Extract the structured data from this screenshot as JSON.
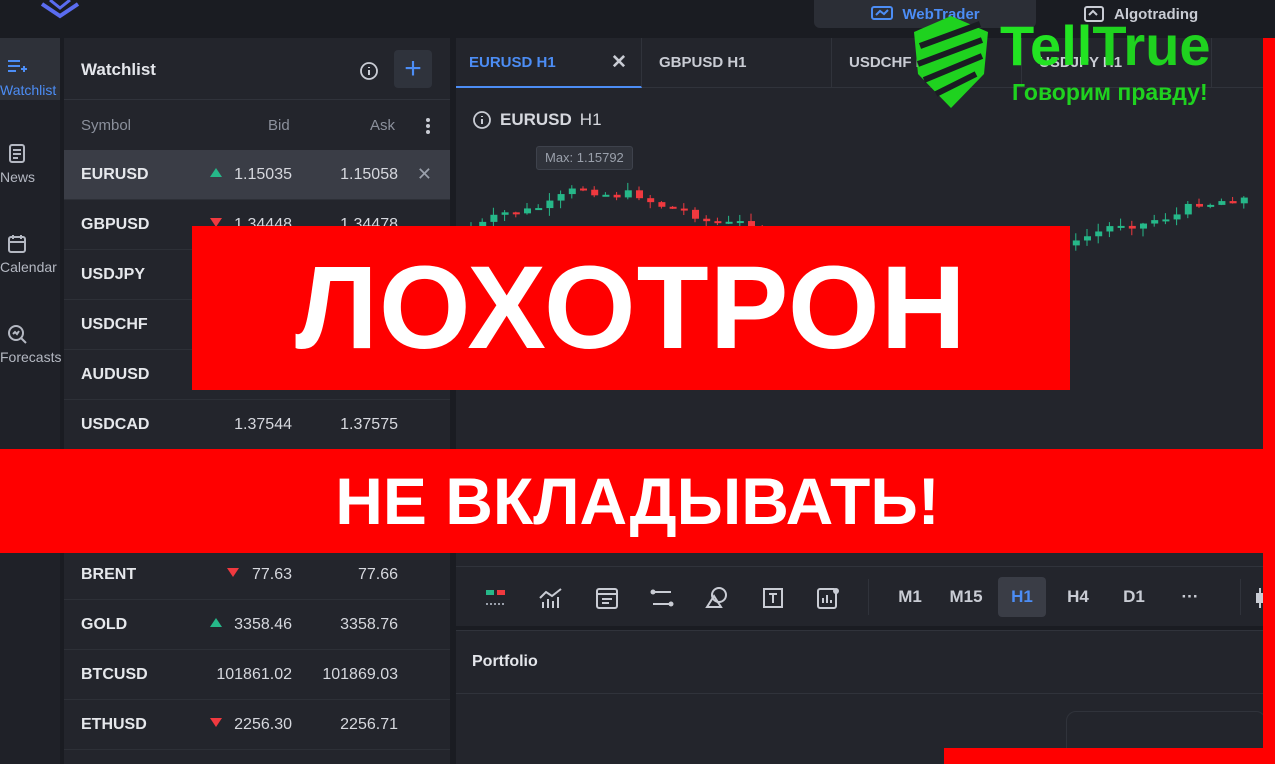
{
  "topbar": {
    "webtrader_label": "WebTrader",
    "algotrading_label": "Algotrading"
  },
  "nav": {
    "items": [
      {
        "label": "Watchlist",
        "icon": "watchlist-icon"
      },
      {
        "label": "News",
        "icon": "news-icon"
      },
      {
        "label": "Calendar",
        "icon": "calendar-icon"
      },
      {
        "label": "Forecasts",
        "icon": "forecasts-icon"
      }
    ]
  },
  "watchlist": {
    "title": "Watchlist",
    "columns": {
      "symbol": "Symbol",
      "bid": "Bid",
      "ask": "Ask"
    },
    "rows": [
      {
        "symbol": "EURUSD",
        "bid": "1.15035",
        "ask": "1.15058",
        "dir": "up",
        "selected": true
      },
      {
        "symbol": "GBPUSD",
        "bid": "1.34448",
        "ask": "1.34478",
        "dir": "down"
      },
      {
        "symbol": "USDJPY",
        "bid": "",
        "ask": "",
        "dir": ""
      },
      {
        "symbol": "USDCHF",
        "bid": "",
        "ask": "",
        "dir": ""
      },
      {
        "symbol": "AUDUSD",
        "bid": "",
        "ask": "",
        "dir": ""
      },
      {
        "symbol": "USDCAD",
        "bid": "1.37544",
        "ask": "1.37575",
        "dir": ""
      },
      {
        "symbol": "",
        "bid": "",
        "ask": "",
        "dir": ""
      },
      {
        "symbol": "",
        "bid": "",
        "ask": "",
        "dir": ""
      },
      {
        "symbol": "BRENT",
        "bid": "77.63",
        "ask": "77.66",
        "dir": "down"
      },
      {
        "symbol": "GOLD",
        "bid": "3358.46",
        "ask": "3358.76",
        "dir": "up"
      },
      {
        "symbol": "BTCUSD",
        "bid": "101861.02",
        "ask": "101869.03",
        "dir": ""
      },
      {
        "symbol": "ETHUSD",
        "bid": "2256.30",
        "ask": "2256.71",
        "dir": "down"
      }
    ]
  },
  "chart_tabs": [
    {
      "label": "EURUSD H1",
      "active": true
    },
    {
      "label": "GBPUSD H1"
    },
    {
      "label": "USDCHF H1"
    },
    {
      "label": "USDJPY H1"
    }
  ],
  "chart": {
    "symbol": "EURUSD",
    "timeframe": "H1",
    "max_label": "Max: 1.15792"
  },
  "timeframes": [
    "M1",
    "M15",
    "H1",
    "H4",
    "D1",
    "···"
  ],
  "active_timeframe": "H1",
  "portfolio": {
    "title": "Portfolio"
  },
  "overlay": {
    "headline": "ЛОХОТРОН",
    "subline": "НЕ ВКЛАДЫВАТЬ!"
  },
  "brand": {
    "name_part1": "Tell",
    "name_part2": "True",
    "slogan": "Говорим правду!",
    "color": "#22e322"
  },
  "colors": {
    "accent": "#4c8df5",
    "up": "#26b889",
    "down": "#f0393f",
    "overlay_red": "#ff0000"
  }
}
